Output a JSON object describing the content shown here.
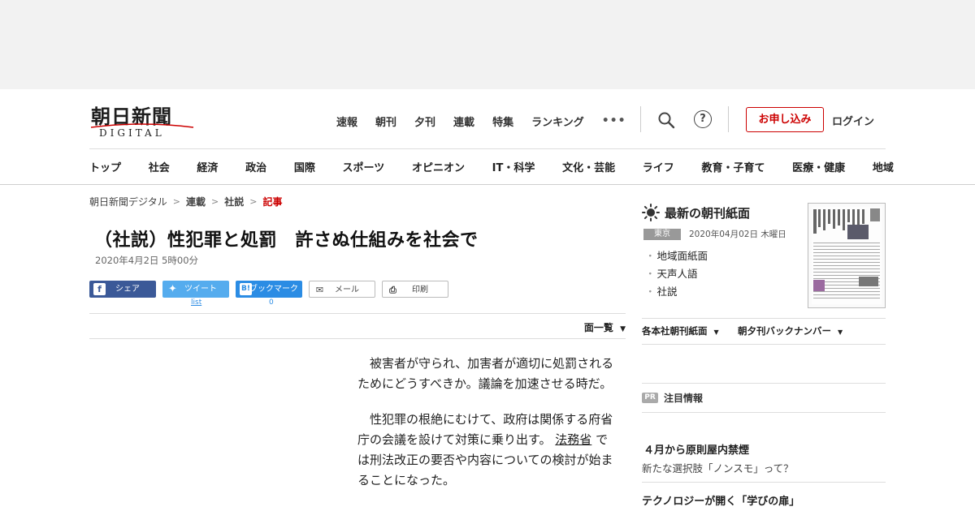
{
  "header": {
    "logo": {
      "title": "朝日新聞",
      "subtitle": "DIGITAL"
    },
    "top_nav": [
      "速報",
      "朝刊",
      "夕刊",
      "連載",
      "特集",
      "ランキング"
    ],
    "more_label": "•••",
    "help_label": "?",
    "apply_label": "お申し込み",
    "login_label": "ログイン"
  },
  "category_nav": [
    "トップ",
    "社会",
    "経済",
    "政治",
    "国際",
    "スポーツ",
    "オピニオン",
    "IT・科学",
    "文化・芸能",
    "ライフ",
    "教育・子育て",
    "医療・健康",
    "地域"
  ],
  "breadcrumb": [
    "朝日新聞デジタル",
    "連載",
    "社説",
    "記事"
  ],
  "article": {
    "title": "（社説）性犯罪と処罰　許さぬ仕組みを社会で",
    "date": "2020年4月2日 5時00分",
    "share": {
      "facebook": "シェア",
      "twitter": "ツイート",
      "twitter_count": "list",
      "hatena": "ブックマーク",
      "hatena_icon": "B!",
      "hatena_count": "0",
      "mail": "メール",
      "print": "印刷"
    },
    "menkiri_label": "面一覧",
    "p1": "被害者が守られ、加害者が適切に処罰されるためにどうすべきか。議論を加速させる時だ。",
    "p2_a": "性犯罪の根絶にむけて、政府は関係する府省庁の会議を設けて対策に乗り出す。",
    "p2_link": "法務省",
    "p2_b": "では刑法改正の要否や内容についての検討が始まることになった。"
  },
  "sidebar": {
    "paper_title": "最新の朝刊紙面",
    "region_tag": "東京",
    "paper_date": "2020年04月02日 木曜日",
    "paper_links": [
      "地域面紙面",
      "天声人語",
      "社説"
    ],
    "dropdown_1": "各本社朝刊紙面",
    "dropdown_2": "朝夕刊バックナンバー",
    "pr_badge": "PR",
    "pr_title": "注目情報",
    "pr_item1_title": "４月から原則屋内禁煙",
    "pr_item1_sub": "新たな選択肢「ノンスモ」って？",
    "pr_item2_title": "テクノロジーが開く「学びの扉」"
  },
  "colors": {
    "accent_red": "#cc0000",
    "facebook": "#3b5998",
    "twitter": "#55acee",
    "hatena": "#2b8ce4"
  }
}
